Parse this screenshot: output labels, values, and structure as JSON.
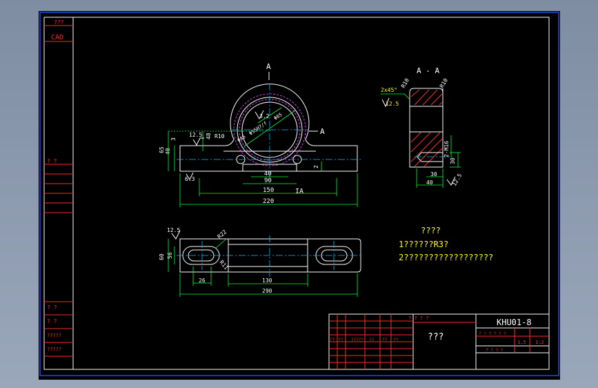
{
  "view_labels": {
    "plan_mark": "A",
    "side_mark": "A",
    "section_title": "A - A",
    "bottom_mark": "IA"
  },
  "front_dims": {
    "d150": "150",
    "d220": "220",
    "d40": "40",
    "d90": "90",
    "h65": "65",
    "h40": "40",
    "h3": "3",
    "h48": "48",
    "r10": "R10",
    "rough1": "12.5",
    "rough2": "6.3",
    "d2": "2",
    "dia1": "Φ45",
    "dia2": "Φ55H7/f",
    "dia3": "Φ65",
    "v32": "3.2"
  },
  "section_dims": {
    "chamfer": "2x45°",
    "rough": "12.5",
    "r10a": "R10",
    "r10b": "R10",
    "m16": "2-M16",
    "d30v": "30",
    "d30h": "30",
    "d40": "40",
    "r125": "12.5"
  },
  "plan_dims": {
    "rough": "12.5",
    "r22": "R22",
    "r11": "R11",
    "h60": "60",
    "h56": "56",
    "d26": "26",
    "d130": "130",
    "d290": "290"
  },
  "notes": {
    "title": "????",
    "line1": "1??????R3?",
    "line2": "2??????????????????"
  },
  "left_strip": {
    "top": "???",
    "cad": "CAD",
    "mid": "?   ?",
    "low1": "?   ?",
    "low2": "?   ?",
    "low3": "?????",
    "low4": "?????"
  },
  "title_block": {
    "drawing_no": "KHU01-8",
    "name": "???",
    "header": "? ? ? ?",
    "row_a": "?  ?  ?  ?  ?  ?",
    "scale_1": "1.5",
    "scale_2": "1:2",
    "sheet": "?   ?   ?   ?",
    "cells": [
      "??",
      "??",
      "?????",
      "??",
      "??",
      "??"
    ]
  },
  "colors": {
    "background": "#000000",
    "outline": "#ffffff",
    "dimension": "#00ff3c",
    "center": "#00bfff",
    "text": "#ffff00",
    "table": "#ff2a2a",
    "hatch": "#ff2a2a"
  }
}
